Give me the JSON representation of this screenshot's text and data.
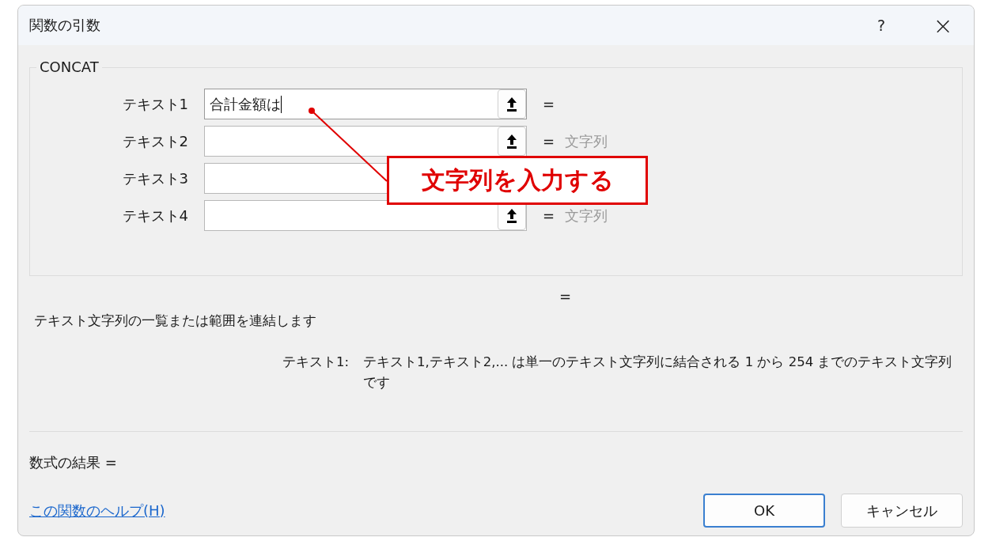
{
  "window": {
    "title": "関数の引数",
    "help_glyph": "?",
    "close_glyph": "×"
  },
  "function_group": {
    "title": "CONCAT",
    "args": [
      {
        "label": "テキスト1",
        "value": "合計金額は",
        "focused": true,
        "ref_button": true,
        "equals": "="
      },
      {
        "label": "テキスト2",
        "focused": false,
        "ref_button": true,
        "equals": "=",
        "result": "文字列"
      },
      {
        "label": "テキスト3",
        "focused": false,
        "ref_button": false
      },
      {
        "label": "テキスト4",
        "focused": false,
        "ref_button": true,
        "equals": "=",
        "result": "文字列"
      }
    ]
  },
  "function_result": "=",
  "description": "テキスト文字列の一覧または範囲を連結します",
  "arg_help": {
    "label": "テキスト1:",
    "text": "テキスト1,テキスト2,...  は単一のテキスト文字列に結合される 1 から 254 までのテキスト文字列です"
  },
  "formula_result": "数式の結果 =",
  "help_link": "この関数のヘルプ(H)",
  "buttons": [
    {
      "label": "OK",
      "default": true
    },
    {
      "label": "キャンセル",
      "default": false
    }
  ],
  "callout": {
    "text": "文字列を入力する"
  }
}
